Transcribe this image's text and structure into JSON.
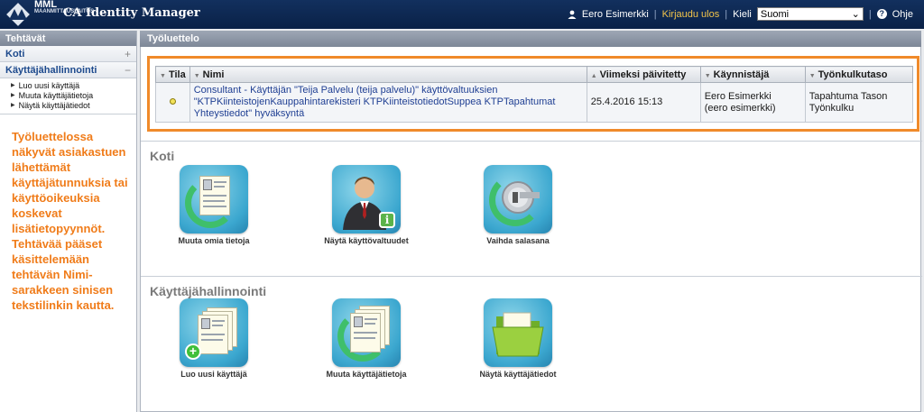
{
  "header": {
    "logo_main": "MML",
    "logo_sub": "MAANMITTAUSLAITOS",
    "app_title": "CA Identity Manager",
    "user_name": "Eero Esimerkki",
    "logout_label": "Kirjaudu ulos",
    "language_label": "Kieli",
    "language_value": "Suomi",
    "help_label": "Ohje",
    "icons": [
      "user-icon",
      "help-icon"
    ]
  },
  "sidebar": {
    "title": "Tehtävät",
    "items": [
      {
        "label": "Koti",
        "control": "+"
      },
      {
        "label": "Käyttäjähallinnointi",
        "control": "−"
      }
    ],
    "sub_items": [
      "Luo uusi käyttäjä",
      "Muuta käyttäjätietoja",
      "Näytä käyttäjätiedot"
    ],
    "note": "Työluettelossa näkyvät asiakastuen lähettämät käyttäjätunnuksia tai käyttöoikeuksia koskevat lisätietopyynnöt. Tehtävää pääset käsittelemään tehtävän Nimi-sarakkeen sinisen tekstilinkin kautta."
  },
  "worklist": {
    "title": "Työluettelo",
    "columns": [
      "Tila",
      "Nimi",
      "Viimeksi päivitetty",
      "Käynnistäjä",
      "Työnkulkutaso"
    ],
    "rows": [
      {
        "name": "Consultant - Käyttäjän \"Teija Palvelu (teija palvelu)\" käyttövaltuuksien \"KTPKiinteistojenKauppahintarekisteri KTPKiinteistotiedotSuppea KTPTapahtumat Yhteystiedot\" hyväksyntä",
        "updated": "25.4.2016 15:13",
        "starter_line1": "Eero Esimerkki",
        "starter_line2": "(eero esimerkki)",
        "level_line1": "Tapahtuma Tason",
        "level_line2": "Työnkulku"
      }
    ],
    "highlight_color": "#f08a2a"
  },
  "sections": [
    {
      "title": "Koti",
      "tiles": [
        "Muuta omia tietoja",
        "Näytä käyttövaltuudet",
        "Vaihda salasana"
      ]
    },
    {
      "title": "Käyttäjähallinnointi",
      "tiles": [
        "Luo uusi käyttäjä",
        "Muuta käyttäjätietoja",
        "Näytä käyttäjätiedot"
      ]
    }
  ],
  "colors": {
    "header_bg": "#12305e",
    "logout": "#f3c44a",
    "note": "#f07c1a",
    "link": "#1f3f93"
  }
}
